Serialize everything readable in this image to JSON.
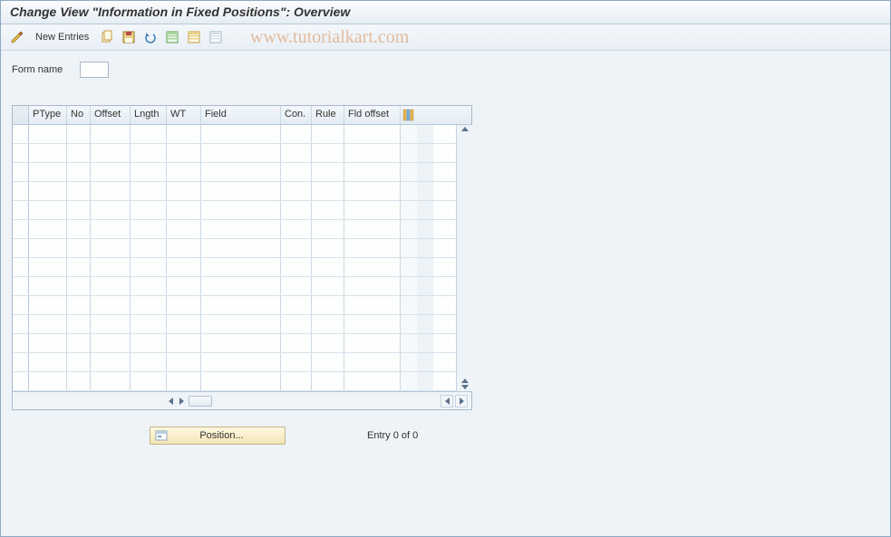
{
  "title": "Change View \"Information in Fixed Positions\": Overview",
  "toolbar": {
    "new_entries": "New Entries"
  },
  "watermark": "www.tutorialkart.com",
  "form": {
    "name_label": "Form name",
    "name_value": ""
  },
  "table": {
    "columns": {
      "ptype": "PType",
      "no": "No",
      "offset": "Offset",
      "lngth": "Lngth",
      "wt": "WT",
      "field": "Field",
      "con": "Con.",
      "rule": "Rule",
      "fld_offset": "Fld offset"
    },
    "row_count": 14
  },
  "footer": {
    "position_label": "Position...",
    "entry_text": "Entry 0 of 0"
  },
  "icons": {
    "toggle": "toggle-display-change",
    "copy": "copy-as",
    "save": "save",
    "undo": "undo",
    "select_all": "select-all",
    "select_block": "select-block",
    "deselect": "deselect-all",
    "configure": "configure-columns",
    "position": "position"
  }
}
